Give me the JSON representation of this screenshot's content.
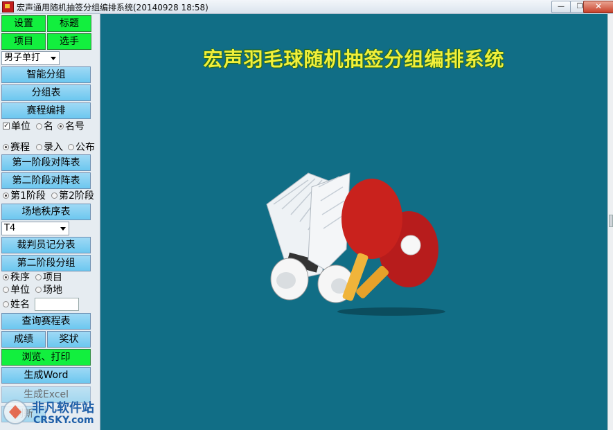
{
  "window": {
    "title": "宏声通用随机抽签分组编排系统(20140928 18:58)",
    "minimize": "—",
    "maximize": "❐",
    "close": "✕"
  },
  "sidebar": {
    "settings": "设置",
    "titles": "标题",
    "events": "项目",
    "players": "选手",
    "event_select": "男子单打",
    "smart_group": "智能分组",
    "group_table": "分组表",
    "schedule": "赛程编排",
    "opt_unit": "单位",
    "opt_name": "名",
    "opt_rank_no": "名号",
    "opt_schedule": "赛程",
    "opt_entry": "录入",
    "opt_publish": "公布",
    "stage1_table": "第一阶段对阵表",
    "stage2_table": "第二阶段对阵表",
    "opt_stage1": "第1阶段",
    "opt_stage2": "第2阶段",
    "venue_order": "场地秩序表",
    "venue_select": "T4",
    "referee_sheet": "裁判员记分表",
    "stage2_group": "第二阶段分组",
    "opt_order": "秩序",
    "opt_event": "项目",
    "opt_unit2": "单位",
    "opt_venue": "场地",
    "opt_fullname": "姓名",
    "query_schedule": "查询赛程表",
    "results": "成绩",
    "awards": "奖状",
    "browse_print": "浏览、打印",
    "gen_word": "生成Word",
    "gen_excel": "生成Excel",
    "refresh": "刷新"
  },
  "main": {
    "title": "宏声羽毛球随机抽签分组编排系统"
  },
  "watermark": {
    "line1": "非凡软件站",
    "line2": "CRSKY.com"
  },
  "colors": {
    "main_bg": "#116e86",
    "title_text": "#f1ef3a",
    "green_button": "#12ef3e",
    "blue_button": "#6cc7ef"
  }
}
